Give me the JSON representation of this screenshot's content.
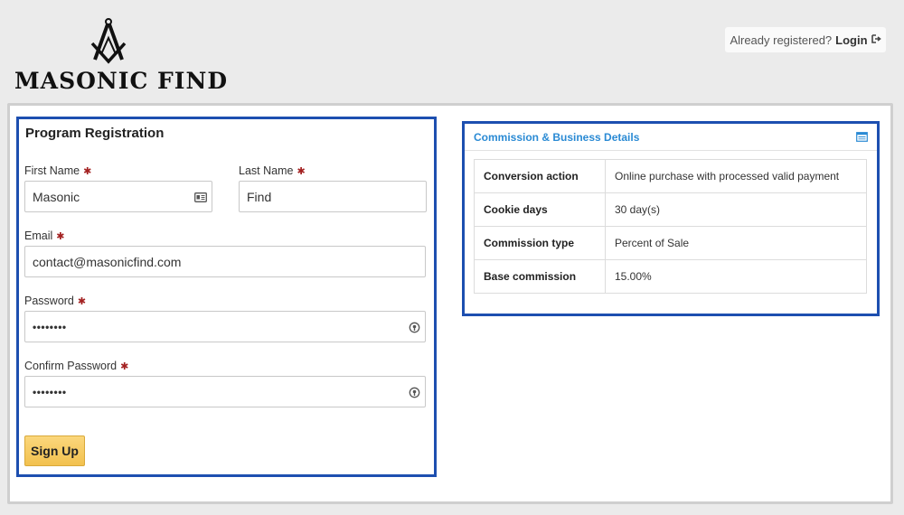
{
  "brand": {
    "name": "MASONIC FIND"
  },
  "header": {
    "already_text": "Already registered?",
    "login_label": "Login",
    "login_icon": "sign-in-icon"
  },
  "registration": {
    "title": "Program Registration",
    "required_mark": "✱",
    "fields": {
      "first_name": {
        "label": "First Name",
        "value": "Masonic"
      },
      "last_name": {
        "label": "Last Name",
        "value": "Find"
      },
      "email": {
        "label": "Email",
        "value": "contact@masonicfind.com"
      },
      "password": {
        "label": "Password",
        "value": "••••••••"
      },
      "confirm_password": {
        "label": "Confirm Password",
        "value": "••••••••"
      }
    },
    "signup_label": "Sign Up"
  },
  "commission": {
    "title": "Commission & Business Details",
    "rows": [
      {
        "key": "Conversion action",
        "value": "Online purchase with processed valid payment"
      },
      {
        "key": "Cookie days",
        "value": "30 day(s)"
      },
      {
        "key": "Commission type",
        "value": "Percent of Sale"
      },
      {
        "key": "Base commission",
        "value": "15.00%"
      }
    ]
  },
  "colors": {
    "accent_blue": "#1d4fb0",
    "link_blue": "#2a8ad4",
    "required_red": "#a32020",
    "button_yellow": "#f2c14f"
  }
}
